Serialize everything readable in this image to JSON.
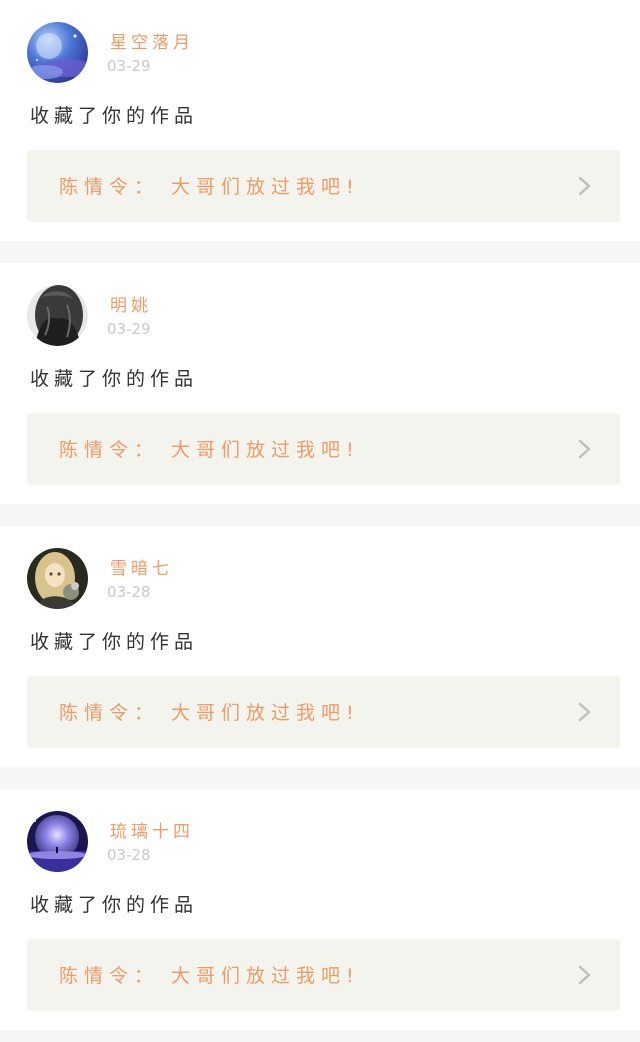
{
  "colors": {
    "accent": "#ef9b66",
    "card_background": "#ffffff",
    "link_background": "#f4f4ee",
    "page_background": "#f7f6f6",
    "timestamp": "#c9c9c9",
    "text": "#333333",
    "chevron": "#bdbdbd"
  },
  "notifications": [
    {
      "username": "星空落月",
      "date": "03-29",
      "action": "收藏了你的作品",
      "work_title": "陈情令：  大哥们放过我吧!",
      "avatar": "night-sky-moon-avatar",
      "chevron_icon": "chevron-right-icon"
    },
    {
      "username": "明姚",
      "date": "03-29",
      "action": "收藏了你的作品",
      "work_title": "陈情令：  大哥们放过我吧!",
      "avatar": "dark-hair-girl-avatar",
      "chevron_icon": "chevron-right-icon"
    },
    {
      "username": "雪暗七",
      "date": "03-28",
      "action": "收藏了你的作品",
      "work_title": "陈情令：  大哥们放过我吧!",
      "avatar": "blonde-doll-avatar",
      "chevron_icon": "chevron-right-icon"
    },
    {
      "username": "琉璃十四",
      "date": "03-28",
      "action": "收藏了你的作品",
      "work_title": "陈情令：  大哥们放过我吧!",
      "avatar": "purple-planet-avatar",
      "chevron_icon": "chevron-right-icon"
    }
  ]
}
